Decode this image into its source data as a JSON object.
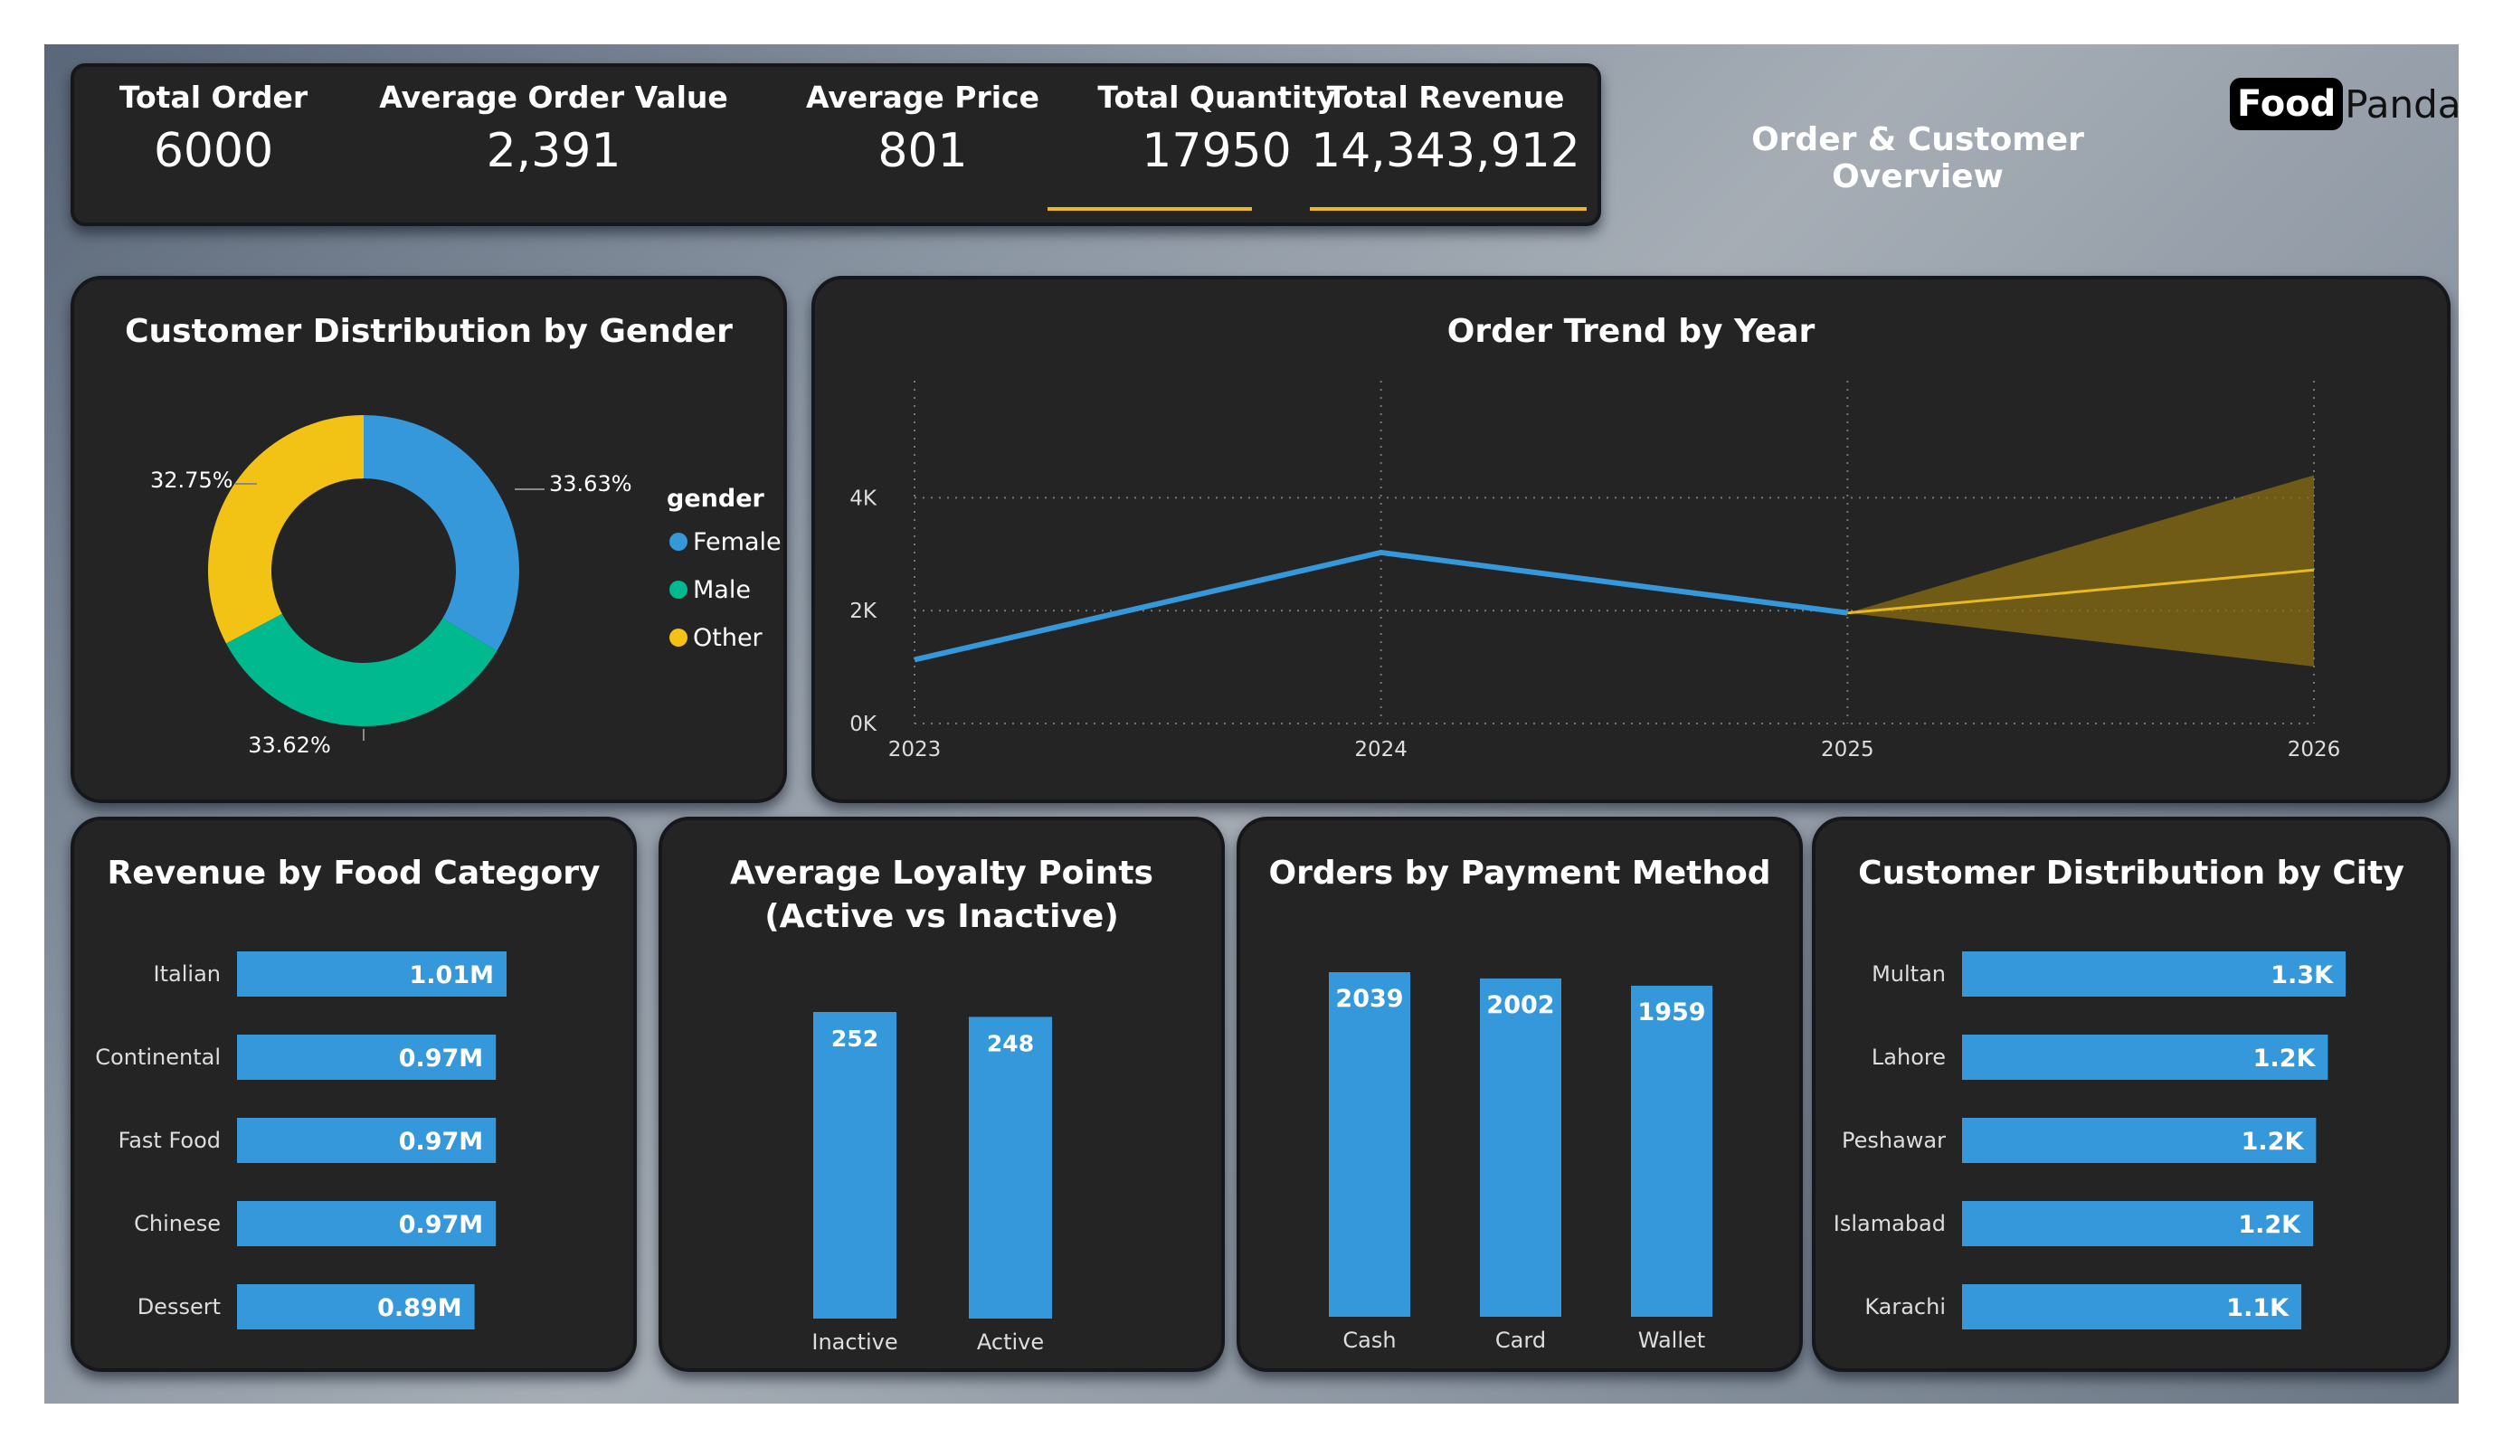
{
  "header": {
    "title": "Order & Customer Overview",
    "logo_a": "Food",
    "logo_b": "Panda"
  },
  "kpis": [
    {
      "label": "Total Order",
      "value": "6000"
    },
    {
      "label": "Average Order Value",
      "value": "2,391"
    },
    {
      "label": "Average Price",
      "value": "801"
    },
    {
      "label": "Total Quantity",
      "value": "17950"
    },
    {
      "label": "Total Revenue",
      "value": "14,343,912"
    }
  ],
  "colors": {
    "accent": "#e8b923",
    "bar": "#3598db",
    "card": "#242424"
  },
  "chart_data": [
    {
      "type": "pie",
      "title": "Customer Distribution by Gender",
      "legend_title": "gender",
      "legend_position": "right",
      "slices": [
        {
          "label": "Female",
          "value": 33.63,
          "display": "33.63%",
          "color": "#3598db"
        },
        {
          "label": "Male",
          "value": 33.62,
          "display": "33.62%",
          "color": "#00b98e"
        },
        {
          "label": "Other",
          "value": 32.75,
          "display": "32.75%",
          "color": "#f2c314"
        }
      ]
    },
    {
      "type": "line",
      "title": "Order Trend by Year",
      "x": [
        "2023",
        "2024",
        "2025",
        "2026"
      ],
      "series": [
        {
          "values": [
            1130,
            3030,
            1960,
            null
          ],
          "color": "#3598db"
        }
      ],
      "forecast": {
        "x": [
          "2025",
          "2026"
        ],
        "values": [
          1960,
          2720
        ],
        "upper": [
          1960,
          4400
        ],
        "lower": [
          1960,
          1010
        ],
        "color": "#e8b923"
      },
      "ylim": [
        0,
        5000
      ],
      "yticks": [
        0,
        2000,
        4000
      ],
      "ytick_labels": [
        "0K",
        "2K",
        "4K"
      ],
      "grid": true
    },
    {
      "type": "bar",
      "orientation": "horizontal",
      "title": "Revenue by Food Category",
      "categories": [
        "Italian",
        "Continental",
        "Fast Food",
        "Chinese",
        "Dessert"
      ],
      "values": [
        1.01,
        0.97,
        0.97,
        0.97,
        0.89
      ],
      "labels": [
        "1.01M",
        "0.97M",
        "0.97M",
        "0.97M",
        "0.89M"
      ],
      "unit": "M"
    },
    {
      "type": "bar",
      "title": "Average Loyalty Points (Active vs Inactive)",
      "categories": [
        "Inactive",
        "Active"
      ],
      "values": [
        252,
        248
      ],
      "labels": [
        "252",
        "248"
      ]
    },
    {
      "type": "bar",
      "title": "Orders by Payment Method",
      "categories": [
        "Cash",
        "Card",
        "Wallet"
      ],
      "values": [
        2039,
        2002,
        1959
      ],
      "labels": [
        "2039",
        "2002",
        "1959"
      ]
    },
    {
      "type": "bar",
      "orientation": "horizontal",
      "title": "Customer Distribution by City",
      "categories": [
        "Multan",
        "Lahore",
        "Peshawar",
        "Islamabad",
        "Karachi"
      ],
      "values": [
        1300,
        1240,
        1200,
        1190,
        1150
      ],
      "labels": [
        "1.3K",
        "1.2K",
        "1.2K",
        "1.2K",
        "1.1K"
      ]
    }
  ]
}
